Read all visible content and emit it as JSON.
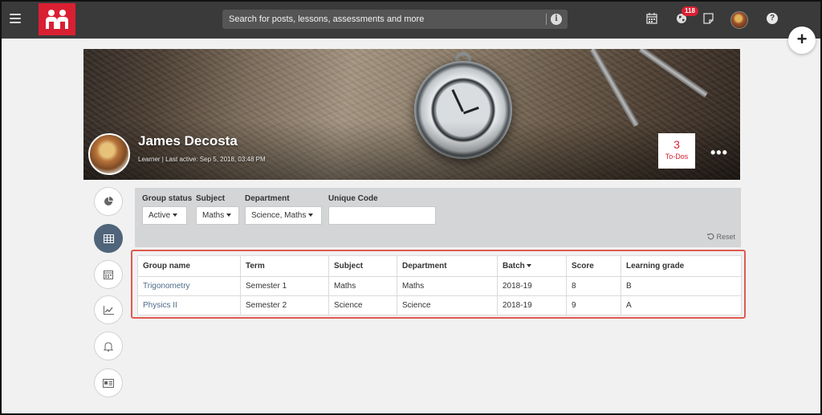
{
  "topbar": {
    "search_placeholder": "Search for posts, lessons, assessments and more",
    "notification_count": "118"
  },
  "fab": {
    "label": "+"
  },
  "profile": {
    "name": "James Decosta",
    "meta": "Learner | Last active: Sep 5, 2018, 03:48 PM",
    "todo_count": "3",
    "todo_label": "To-Dos",
    "more_label": "•••"
  },
  "sidenav": {
    "items": [
      "pie-chart-icon",
      "table-icon",
      "calendar-icon",
      "line-chart-icon",
      "bell-icon",
      "id-card-icon"
    ],
    "active": "table-icon"
  },
  "filters": {
    "group_status_label": "Group status",
    "group_status_value": "Active",
    "subject_label": "Subject",
    "subject_value": "Maths",
    "department_label": "Department",
    "department_value": "Science, Maths",
    "unique_code_label": "Unique Code",
    "unique_code_value": "",
    "reset_label": "Reset"
  },
  "table": {
    "headers": [
      "Group name",
      "Term",
      "Subject",
      "Department",
      "Batch",
      "Score",
      "Learning grade"
    ],
    "rows": [
      [
        "Trigonometry",
        "Semester 1",
        "Maths",
        "Maths",
        "2018-19",
        "8",
        "B"
      ],
      [
        "Physics II",
        "Semester 2",
        "Science",
        "Science",
        "2018-19",
        "9",
        "A"
      ]
    ]
  },
  "colors": {
    "brand": "#d92032",
    "highlight_border": "#e05a4f",
    "active_nav": "#50647a",
    "link": "#4d6a8a"
  }
}
